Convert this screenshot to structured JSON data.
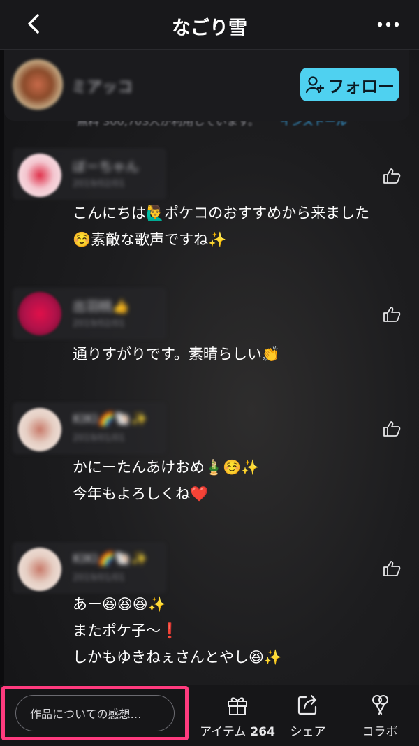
{
  "header": {
    "title": "なごり雪"
  },
  "author": {
    "name": "ミアッコ",
    "follow_label": "フォロー"
  },
  "peek": {
    "text": "無料 300,703人が利用しています。",
    "link": "インストール"
  },
  "comments": [
    {
      "user": "ぼーちゃん",
      "date": "2019/02/01",
      "text": "こんにちは🙋‍♂️ポケコのおすすめから来ました\n☺️素敵な歌声ですね✨",
      "avatar_color": "#e8b6c2"
    },
    {
      "user": "出羽桃👍",
      "date": "2019/02/01",
      "text": "通りすがりです。素晴らしい👏",
      "avatar_color": "#b8144a"
    },
    {
      "user": "KIKI🌈🐚✨",
      "date": "2019/01/01",
      "text": "かにーたんあけおめ🎍☺️✨\n今年もよろしくね❤️",
      "avatar_color": "#d9c2b4"
    },
    {
      "user": "KIKI🌈🐚✨",
      "date": "2019/01/01",
      "text": "あー😆😆😆✨\nまたポケ子〜❗️\nしかもゆきねぇさんとやし😆✨",
      "avatar_color": "#d9c2b4"
    }
  ],
  "bottom": {
    "input_placeholder": "作品についての感想…",
    "items_label": "アイテム",
    "items_count": "264",
    "share_label": "シェア",
    "collab_label": "コラボ"
  },
  "colors": {
    "follow_bg": "#4fd1f0",
    "highlight": "#ff3b7e"
  }
}
